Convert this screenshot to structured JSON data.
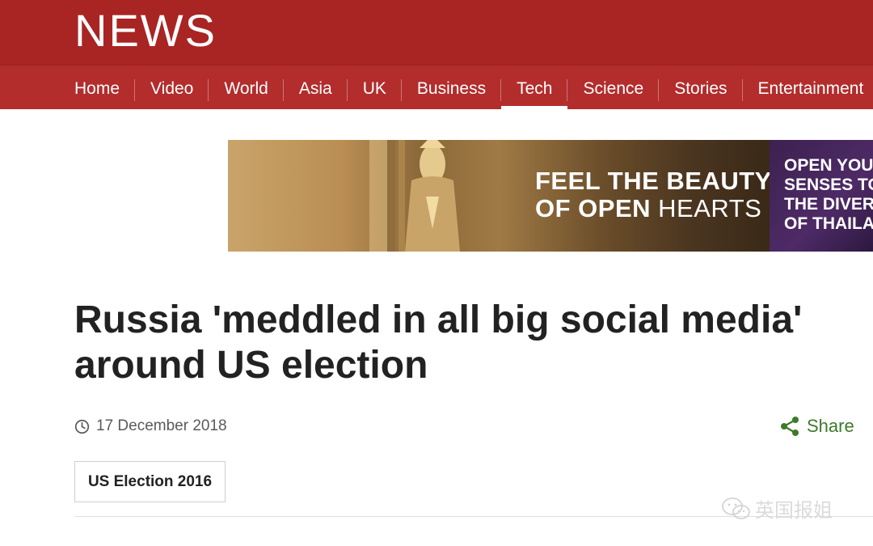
{
  "header": {
    "logo_text": "NEWS",
    "background_color": "#a82524"
  },
  "nav": {
    "items": [
      {
        "label": "Home"
      },
      {
        "label": "Video"
      },
      {
        "label": "World"
      },
      {
        "label": "Asia"
      },
      {
        "label": "UK"
      },
      {
        "label": "Business"
      },
      {
        "label": "Tech",
        "active": true
      },
      {
        "label": "Science"
      },
      {
        "label": "Stories"
      },
      {
        "label": "Entertainment"
      }
    ]
  },
  "ad": {
    "headline_line1": "FEEL THE BEAUTY",
    "headline_line2_bold": "OF OPEN",
    "headline_line2_thin": "HEARTS",
    "side_lines": [
      "OPEN YOUR",
      "SENSES TO",
      "THE DIVERS",
      "OF THAILA"
    ]
  },
  "article": {
    "headline": "Russia 'meddled in all big social media' around US election",
    "date": "17 December 2018",
    "share_label": "Share",
    "tag_label": "US Election 2016"
  },
  "watermark": {
    "text": "英国报姐"
  },
  "colors": {
    "brand_red": "#a82524",
    "share_green": "#3d7a2a"
  }
}
